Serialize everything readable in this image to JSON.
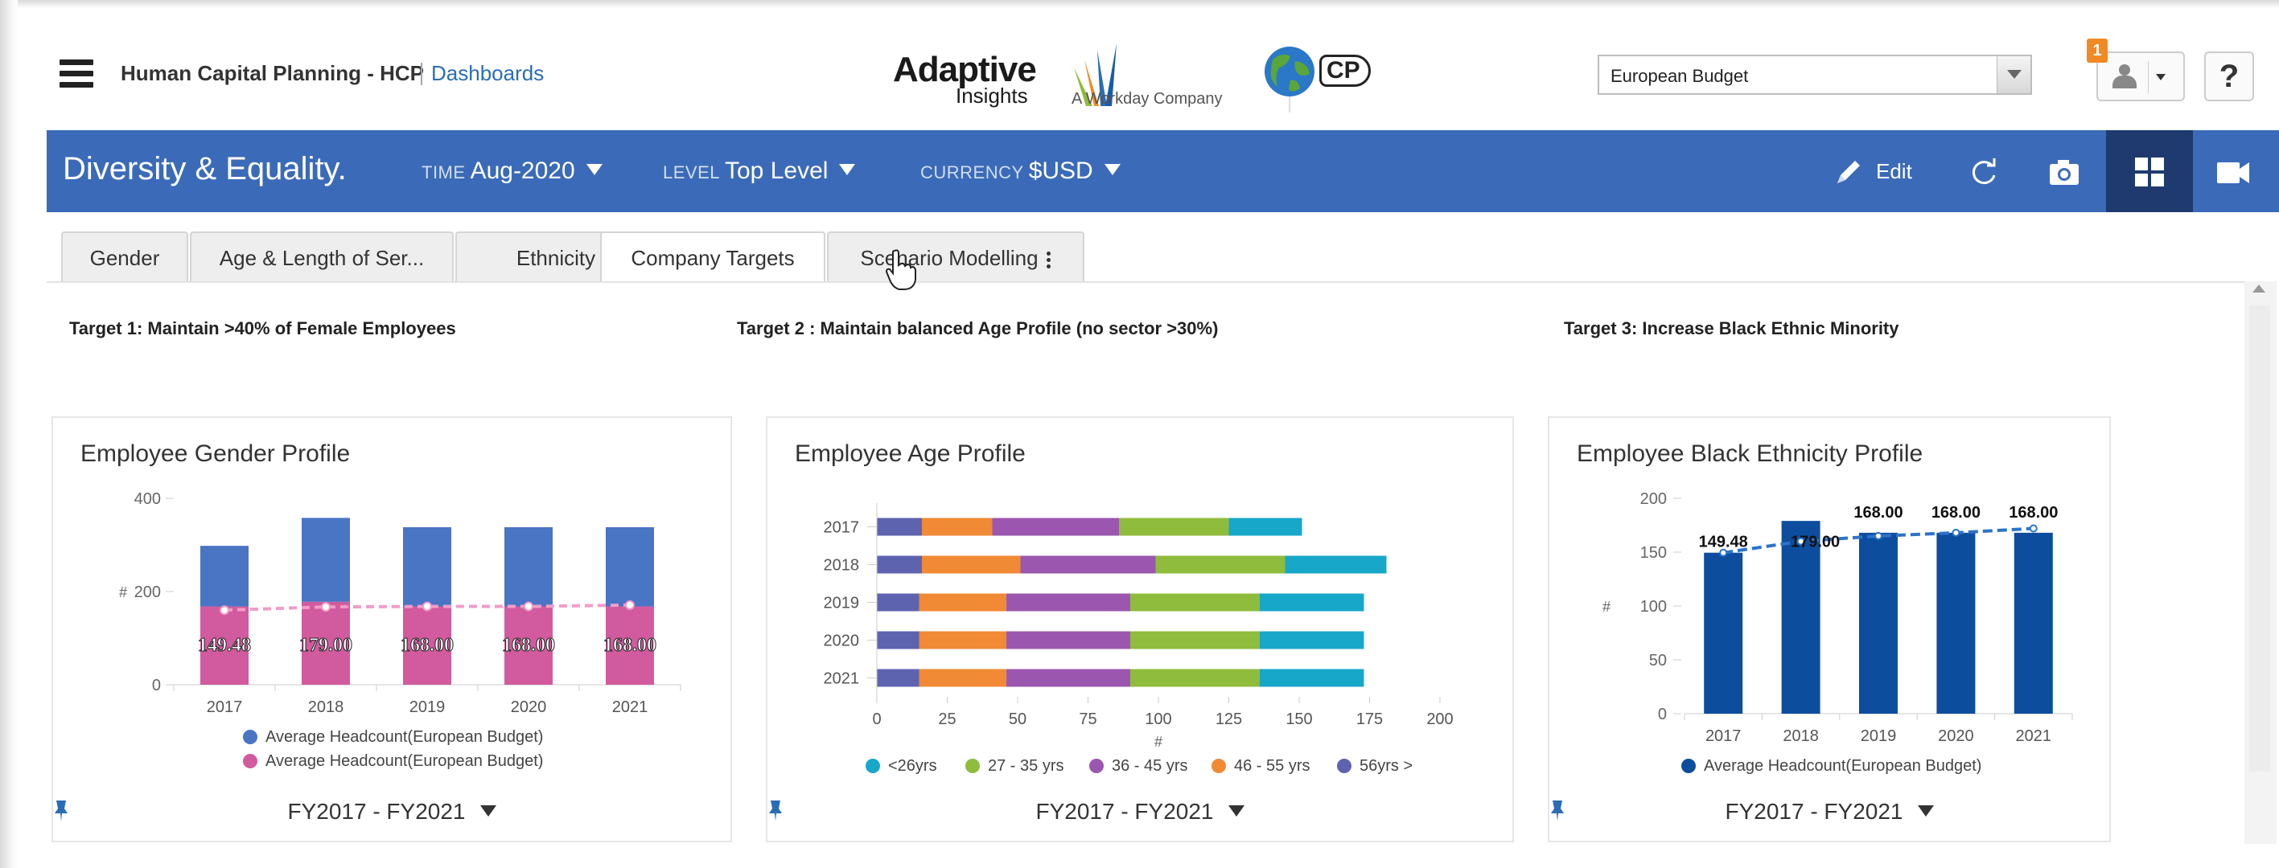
{
  "header": {
    "app_title": "Human Capital Planning - HCP",
    "dashboards_link": "Dashboards",
    "logo_word": "Adaptive",
    "logo_sub": "Insights",
    "logo_company": "A Workday Company",
    "hcp_logo_text": "CP",
    "budget_select": "European Budget",
    "notification_count": "1",
    "help": "?"
  },
  "toolbar": {
    "title": "Diversity & Equality.",
    "time_key": "TIME",
    "time_val": "Aug-2020",
    "level_key": "LEVEL",
    "level_val": "Top Level",
    "currency_key": "CURRENCY",
    "currency_val": "$USD",
    "edit_label": "Edit"
  },
  "tabs": [
    {
      "label": "Gender"
    },
    {
      "label": "Age & Length of Ser..."
    },
    {
      "label": "Ethnicity"
    },
    {
      "label": "Company Targets"
    },
    {
      "label": "Scenario Modelling"
    }
  ],
  "targets": [
    "Target 1: Maintain >40% of Female Employees",
    "Target 2 : Maintain balanced Age Profile (no sector >30%)",
    "Target 3: Increase Black Ethnic Minority"
  ],
  "footer_period": "FY2017 - FY2021",
  "colors": {
    "accent_blue": "#3b6bb8",
    "bar_blue": "#4a74c4",
    "bar_pink": "#d15b9e",
    "dark_blue": "#0d4d9e",
    "age_lt26": "#17a7c9",
    "age_27_35": "#8fbc3c",
    "age_36_45": "#9b57b0",
    "age_46_55": "#f08a34",
    "age_56": "#5e63b0"
  },
  "chart_data": [
    {
      "type": "bar",
      "title": "Employee Gender Profile",
      "categories": [
        "2017",
        "2018",
        "2019",
        "2020",
        "2021"
      ],
      "ylabel": "#",
      "ylim": [
        0,
        400
      ],
      "yticks": [
        "400",
        "200",
        "0"
      ],
      "stacked": true,
      "series": [
        {
          "name": "Average Headcount(European Budget)",
          "values": [
            130,
            180,
            170,
            170,
            170
          ],
          "color": "#4a74c4"
        },
        {
          "name": "Average Headcount(European Budget)",
          "values": [
            168,
            178,
            168,
            168,
            168
          ],
          "color": "#d15b9e"
        }
      ],
      "line": {
        "values": [
          160,
          167,
          168,
          168,
          171
        ],
        "color": "#f29cc8"
      },
      "data_labels": [
        "149.48",
        "179.00",
        "168.00",
        "168.00",
        "168.00"
      ]
    },
    {
      "type": "bar",
      "orientation": "horizontal",
      "stacked": true,
      "title": "Employee Age Profile",
      "categories": [
        "2017",
        "2018",
        "2019",
        "2020",
        "2021"
      ],
      "xlabel": "#",
      "xlim": [
        0,
        200
      ],
      "xticks": [
        "0",
        "25",
        "50",
        "75",
        "100",
        "125",
        "150",
        "175",
        "200"
      ],
      "series": [
        {
          "name": "<26yrs",
          "values": [
            26,
            36,
            37,
            37,
            37
          ],
          "color": "#17a7c9"
        },
        {
          "name": "27 - 35 yrs",
          "values": [
            39,
            46,
            46,
            46,
            46
          ],
          "color": "#8fbc3c"
        },
        {
          "name": "36 - 45 yrs",
          "values": [
            45,
            48,
            44,
            44,
            44
          ],
          "color": "#9b57b0"
        },
        {
          "name": "46 - 55 yrs",
          "values": [
            25,
            35,
            31,
            31,
            31
          ],
          "color": "#f08a34"
        },
        {
          "name": "56yrs >",
          "values": [
            16,
            16,
            15,
            15,
            15
          ],
          "color": "#5e63b0"
        }
      ],
      "legend_order": [
        "<26yrs",
        "27 - 35 yrs",
        "36 - 45 yrs",
        "46 - 55 yrs",
        "56yrs >"
      ]
    },
    {
      "type": "bar",
      "title": "Employee Black Ethnicity Profile",
      "categories": [
        "2017",
        "2018",
        "2019",
        "2020",
        "2021"
      ],
      "ylabel": "#",
      "ylim": [
        0,
        200
      ],
      "yticks": [
        "200",
        "150",
        "100",
        "50",
        "0"
      ],
      "series": [
        {
          "name": "Average Headcount(European Budget)",
          "values": [
            149.48,
            179,
            168,
            168,
            168
          ],
          "color": "#0d4d9e"
        }
      ],
      "line": {
        "values": [
          149.48,
          160,
          165,
          168,
          172
        ],
        "color": "#2d73c9"
      },
      "data_labels": [
        "149.48",
        "179.00",
        "168.00",
        "168.00",
        "168.00"
      ]
    }
  ]
}
